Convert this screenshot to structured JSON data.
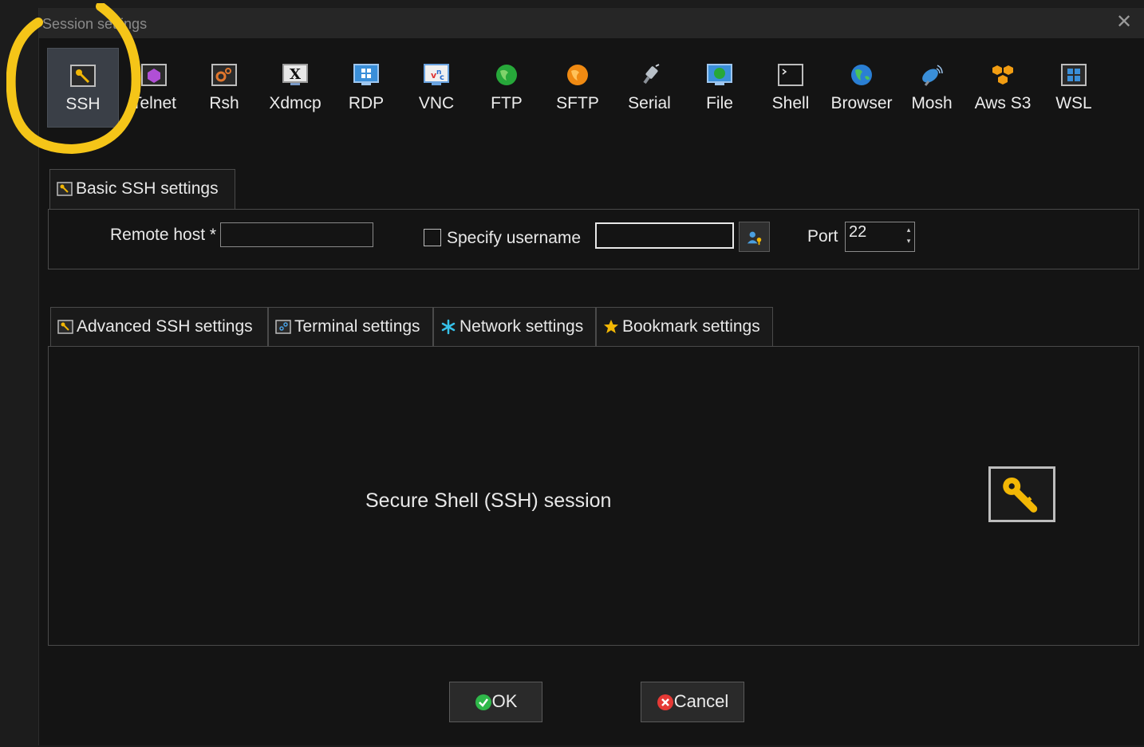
{
  "window": {
    "title": "Session settings",
    "close_icon": "close-icon"
  },
  "toolbar": {
    "items": [
      {
        "label": "SSH",
        "icon": "key-icon",
        "selected": true
      },
      {
        "label": "Telnet",
        "icon": "telnet-icon"
      },
      {
        "label": "Rsh",
        "icon": "rsh-icon"
      },
      {
        "label": "Xdmcp",
        "icon": "x-display-icon"
      },
      {
        "label": "RDP",
        "icon": "monitor-windows-icon"
      },
      {
        "label": "VNC",
        "icon": "vnc-icon"
      },
      {
        "label": "FTP",
        "icon": "green-globe-icon"
      },
      {
        "label": "SFTP",
        "icon": "orange-globe-icon"
      },
      {
        "label": "Serial",
        "icon": "serial-plug-icon"
      },
      {
        "label": "File",
        "icon": "file-monitor-icon"
      },
      {
        "label": "Shell",
        "icon": "terminal-icon"
      },
      {
        "label": "Browser",
        "icon": "earth-icon"
      },
      {
        "label": "Mosh",
        "icon": "satellite-dish-icon"
      },
      {
        "label": "Aws S3",
        "icon": "aws-boxes-icon"
      },
      {
        "label": "WSL",
        "icon": "windows-icon"
      }
    ]
  },
  "basic": {
    "tab_label": "Basic SSH settings",
    "remote_host_label": "Remote host *",
    "remote_host_value": "",
    "specify_username_label": "Specify username",
    "username_value": "",
    "port_label": "Port",
    "port_value": "22"
  },
  "advanced_tabs": [
    {
      "label": "Advanced SSH settings",
      "icon": "key-small-icon"
    },
    {
      "label": "Terminal settings",
      "icon": "terminal-small-icon"
    },
    {
      "label": "Network settings",
      "icon": "network-star-icon"
    },
    {
      "label": "Bookmark settings",
      "icon": "star-icon"
    }
  ],
  "session_description": "Secure Shell (SSH) session",
  "buttons": {
    "ok": "OK",
    "cancel": "Cancel"
  },
  "colors": {
    "annotation": "#f5c518",
    "ok_green": "#2fb84a",
    "cancel_red": "#e53935",
    "key_gold": "#f2b705"
  }
}
